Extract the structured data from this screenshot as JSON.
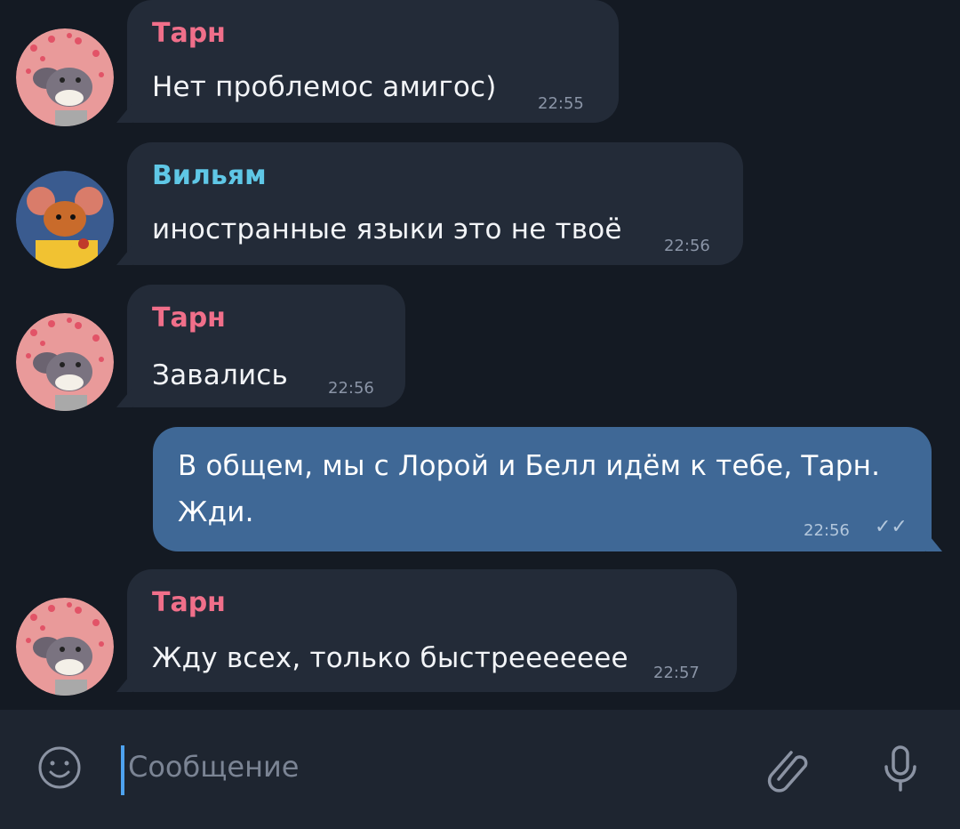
{
  "colors": {
    "background": "#141a23",
    "incoming_bubble": "#232b38",
    "outgoing_bubble": "#3f6896",
    "sender_tarn": "#f06f8a",
    "sender_william": "#5fc7e6",
    "caret": "#4ea3f0"
  },
  "messages": [
    {
      "sender": "Тарн",
      "text": "Нет проблемос амигос)",
      "time": "22:55",
      "avatar": "rat-avatar-hearts"
    },
    {
      "sender": "Вильям",
      "text": "иностранные языки это не твоё",
      "time": "22:56",
      "avatar": "mouse-avatar-yellow"
    },
    {
      "sender": "Тарн",
      "text": "Завались",
      "time": "22:56",
      "avatar": "rat-avatar-hearts"
    },
    {
      "sender": "",
      "text_line1": "В общем, мы с Лорой и Белл идём к тебе, Тарн.",
      "text_line2": "Жди.",
      "time": "22:56",
      "status": "read-double-check"
    },
    {
      "sender": "Тарн",
      "text": "Жду всех, только быстреееееее",
      "time": "22:57",
      "avatar": "rat-avatar-hearts"
    }
  ],
  "composer": {
    "placeholder": "Сообщение",
    "emoji_icon": "smile-icon",
    "attach_icon": "paperclip-icon",
    "mic_icon": "microphone-icon"
  }
}
